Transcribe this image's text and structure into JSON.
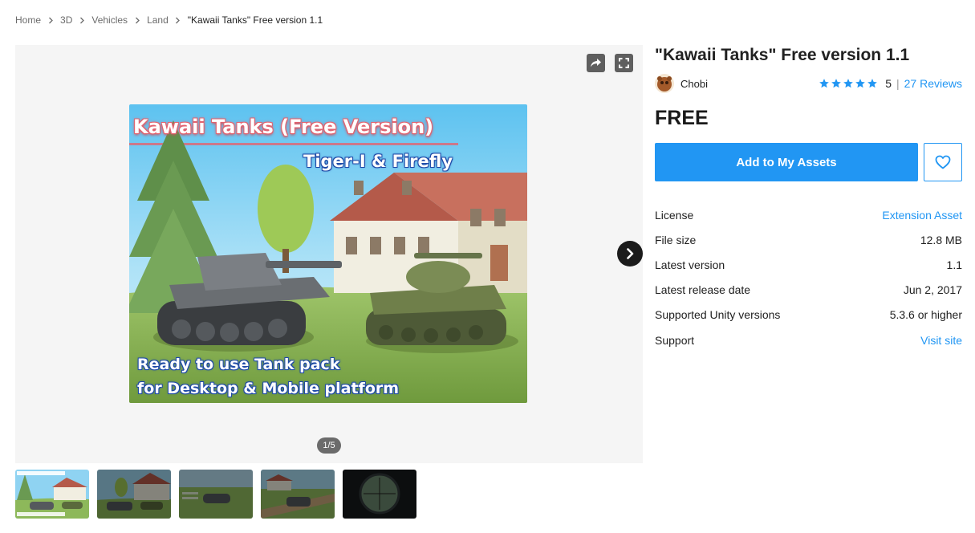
{
  "breadcrumb": [
    "Home",
    "3D",
    "Vehicles",
    "Land",
    "\"Kawaii Tanks\" Free version 1.1"
  ],
  "gallery": {
    "hero_title": "Kawaii Tanks (Free Version)",
    "hero_subtitle": "Tiger-I & Firefly",
    "hero_line1": "Ready to use Tank pack",
    "hero_line2": "for Desktop & Mobile platform",
    "counter": "1/5",
    "thumbnail_count": 5
  },
  "product": {
    "title": "\"Kawaii Tanks\" Free version 1.1",
    "publisher": "Chobi",
    "rating_value": "5",
    "rating_stars": 5,
    "reviews": "27 Reviews",
    "price": "FREE",
    "add_button": "Add to My Assets"
  },
  "details": [
    {
      "label": "License",
      "value": "Extension Asset",
      "link": true
    },
    {
      "label": "File size",
      "value": "12.8 MB",
      "link": false
    },
    {
      "label": "Latest version",
      "value": "1.1",
      "link": false
    },
    {
      "label": "Latest release date",
      "value": "Jun 2, 2017",
      "link": false
    },
    {
      "label": "Supported Unity versions",
      "value": "5.3.6 or higher",
      "link": false
    },
    {
      "label": "Support",
      "value": "Visit site",
      "link": true
    }
  ],
  "colors": {
    "accent": "#2196f3",
    "star": "#2196f3",
    "text": "#212121",
    "viewer_bg": "#f5f5f5"
  },
  "icons": {
    "share": "share-icon",
    "fullscreen": "fullscreen-icon",
    "next": "chevron-right-icon",
    "favorite": "heart-icon",
    "breadcrumb_separator": "chevron-right-icon",
    "star": "star-icon"
  }
}
